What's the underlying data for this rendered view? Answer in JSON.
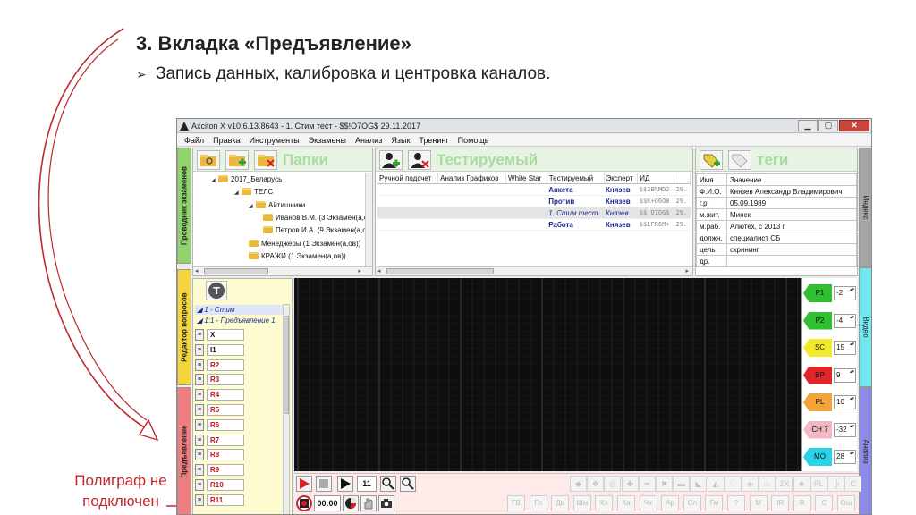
{
  "slide": {
    "title": "3. Вкладка «Предъявление»",
    "bullet": "Запись данных, калибровка и центровка каналов.",
    "note_line1": "Полиграф не",
    "note_line2": "подключен"
  },
  "window": {
    "title": "Axciton X v10.6.13.8643 - 1. Стим тест - $$!O7OG$ 29.11.2017",
    "menu": [
      "Файл",
      "Правка",
      "Инструменты",
      "Экзамены",
      "Анализ",
      "Язык",
      "Тренинг",
      "Помощь"
    ],
    "left_tabs": [
      "Проводник экзаменов",
      "Редактор вопросов",
      "Предъявление"
    ],
    "right_tabs": [
      "Индекс",
      "Видео",
      "Анализ"
    ]
  },
  "folders": {
    "title": "Папки",
    "tree": [
      {
        "label": "2017_Беларусь",
        "level": 0
      },
      {
        "label": "ТЕЛС",
        "level": 1
      },
      {
        "label": "Айтишники",
        "level": 2
      },
      {
        "label": "Иванов В.М. (3 Экзамен(а,о",
        "level": 3
      },
      {
        "label": "Петров И.А. (9 Экзамен(а,о",
        "level": 3
      },
      {
        "label": "Менеджеры (1 Экзамен(а,ов))",
        "level": 2
      },
      {
        "label": "КРАЖИ (1 Экзамен(а,ов))",
        "level": 2
      }
    ]
  },
  "tested": {
    "title": "Тестируемый",
    "columns": [
      "Ручной подсчет",
      "Анализ Графиков",
      "White Star",
      "Тестируемый",
      "Эксперт",
      "ИД"
    ],
    "rows": [
      {
        "name": "Анкета",
        "expert": "Князев",
        "id": "$$2B%MD2",
        "date": "29."
      },
      {
        "name": "Против",
        "expert": "Князев",
        "id": "$$K+O6O8",
        "date": "29."
      },
      {
        "name": "1. Стим тест",
        "expert": "Князев",
        "id": "$$!O7OG$",
        "date": "29."
      },
      {
        "name": "Работа",
        "expert": "Князев",
        "id": "$$LFR6M+",
        "date": "29."
      }
    ]
  },
  "tags": {
    "title": "теги",
    "columns": [
      "Имя",
      "Значение"
    ],
    "rows": [
      {
        "k": "Ф.И.О.",
        "v": "Князев Александр Владимирович"
      },
      {
        "k": "г.р.",
        "v": "05.09.1989"
      },
      {
        "k": "м.жит.",
        "v": "Минск"
      },
      {
        "k": "м.раб.",
        "v": "Алютех, с 2013 г."
      },
      {
        "k": "должн.",
        "v": "специалист СБ"
      },
      {
        "k": "цель",
        "v": "скрининг"
      },
      {
        "k": "др.",
        "v": ""
      }
    ]
  },
  "questions": {
    "header1": "1 - Стим",
    "header2": "1:1 - Предъявление 1",
    "items": [
      "X",
      "I1",
      "R2",
      "R3",
      "R4",
      "R5",
      "R6",
      "R7",
      "R8",
      "R9",
      "R10",
      "R11"
    ]
  },
  "channels": [
    {
      "name": "P1",
      "value": "-2",
      "color": "#2fbf2f"
    },
    {
      "name": "P2",
      "value": "-4",
      "color": "#2fbf2f"
    },
    {
      "name": "SC",
      "value": "15",
      "color": "#f2ea2a"
    },
    {
      "name": "BP",
      "value": "9",
      "color": "#e0262a"
    },
    {
      "name": "PL",
      "value": "10",
      "color": "#f2a43a"
    },
    {
      "name": "CH 7",
      "value": "-32",
      "color": "#f3b8c4"
    },
    {
      "name": "MO",
      "value": "28",
      "color": "#2bd3e8"
    }
  ],
  "toolbar": {
    "page_number": "11",
    "timer": "00:00",
    "gray_buttons": [
      "ГВ",
      "Гл",
      "Дв",
      "Шм",
      "Кх",
      "Ка",
      "Чх",
      "Ар",
      "Сл",
      "Гм",
      "?",
      "М",
      "IR",
      "R",
      "С",
      "Ош"
    ]
  },
  "colors": {
    "accent_red": "#c0282e",
    "folder_green": "#a9dba0"
  }
}
